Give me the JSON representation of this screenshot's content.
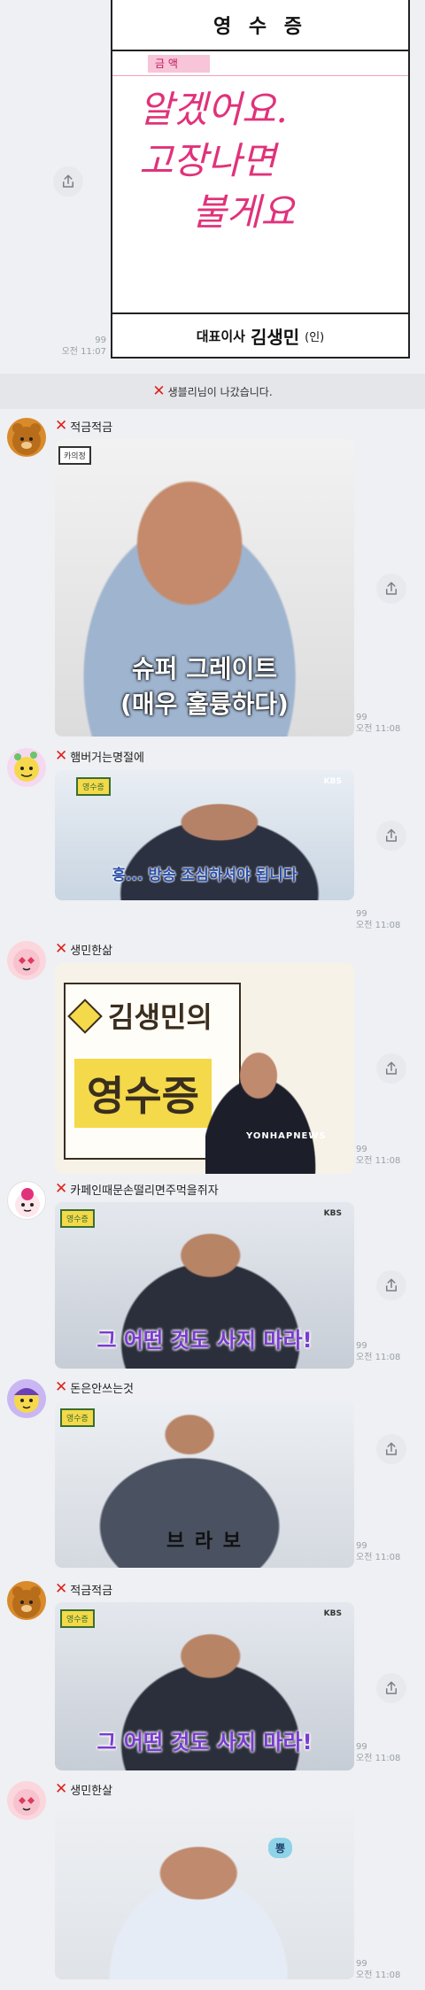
{
  "receipt": {
    "title": "영 수 증",
    "amount_label": "금 액",
    "handwritten_lines": [
      "알겠어요.",
      "고장나면",
      "불게요"
    ],
    "footer_title": "대표이사",
    "footer_name": "김생민",
    "footer_seal": "(인)",
    "read_count": "99",
    "time": "오전 11:07"
  },
  "system_message": "생블리님이 나갔습니다.",
  "messages": [
    {
      "sender": "적금적금",
      "read_count": "99",
      "time": "오전 11:08",
      "subtitle_line1": "슈퍼 그레이트",
      "subtitle_line2": "(매우 훌륭하다)",
      "badge": "카의정"
    },
    {
      "sender": "햄버거는명절에",
      "read_count": "99",
      "time": "오전 11:08",
      "subtitle_line1": "흥... 방송 조심하셔야 됩니다",
      "badge": "영수증",
      "broadcaster": "KBS"
    },
    {
      "sender": "생민한삶",
      "read_count": "99",
      "time": "오전 11:08",
      "title_line1": "김생민의",
      "title_line2": "영수증",
      "watermark": "YONHAPNEWS"
    },
    {
      "sender": "카페인때문손떨리면주먹을쥐자",
      "read_count": "99",
      "time": "오전 11:08",
      "subtitle_line1": "그 어떤 것도 사지 마라!",
      "badge": "영수증",
      "broadcaster": "KBS"
    },
    {
      "sender": "돈은안쓰는것",
      "read_count": "99",
      "time": "오전 11:08",
      "subtitle_line1": "브 라 보",
      "badge": "영수증"
    },
    {
      "sender": "적금적금",
      "read_count": "99",
      "time": "오전 11:08",
      "subtitle_line1": "그 어떤 것도 사지 마라!",
      "badge": "영수증",
      "broadcaster": "KBS"
    },
    {
      "sender": "생민한살",
      "read_count": "99",
      "time": "오전 11:08",
      "badge": "뿅"
    }
  ],
  "colors": {
    "background": "#eef0f3",
    "exit_mark": "#e0201b",
    "handwriting": "#e0327a",
    "subtitle_purple": "#7a3bd0",
    "receipt_yellow": "#f4d94a"
  }
}
